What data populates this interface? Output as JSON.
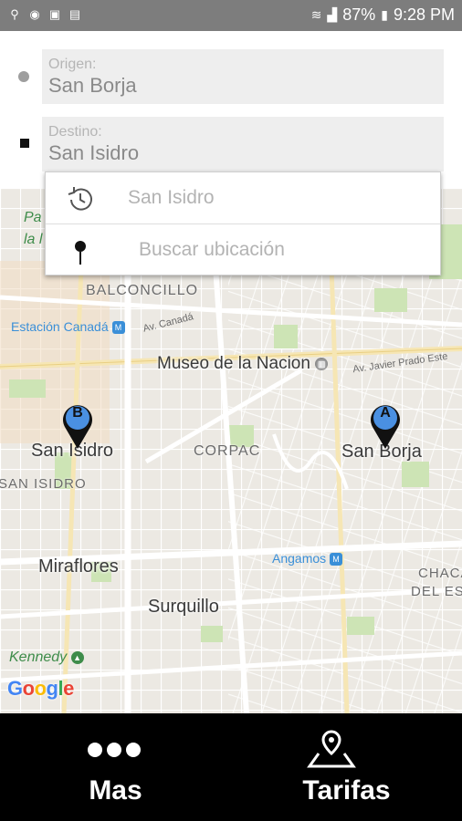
{
  "status_bar": {
    "battery": "87%",
    "time": "9:28 PM",
    "left_icons": [
      "usb-icon",
      "record-icon",
      "office-icon",
      "clipboard-icon"
    ],
    "right_icons": [
      "wifi-icon",
      "signal-icon",
      "battery-icon"
    ]
  },
  "form": {
    "origin_label": "Origen:",
    "origin_value": "San Borja",
    "dest_label": "Destino:",
    "dest_value": "San Isidro"
  },
  "suggestions": [
    {
      "icon": "history-icon",
      "text": "San Isidro"
    },
    {
      "icon": "location-pin-icon",
      "text": "Buscar ubicación"
    }
  ],
  "map": {
    "labels": {
      "balconcillo": "BALCONCILLO",
      "estacion_canada": "Estación Canadá",
      "av_canada": "Av. Canadá",
      "museo": "Museo de la Nacion",
      "javier_prado": "Av. Javier Prado Este",
      "san_isidro": "San Isidro",
      "san_isidro_area": "SAN ISIDRO",
      "corpac": "CORPAC",
      "san_borja": "San Borja",
      "angamos": "Angamos",
      "chaca": "CHACA",
      "del_est": "DEL EST",
      "miraflores": "Miraflores",
      "surquillo": "Surquillo",
      "kennedy": "Kennedy",
      "pa": "Pa",
      "la_l": "la l"
    },
    "markers": [
      {
        "letter": "B",
        "color": "#4a90e2"
      },
      {
        "letter": "A",
        "color": "#4a90e2"
      }
    ],
    "google": [
      "G",
      "o",
      "o",
      "g",
      "l",
      "e"
    ],
    "google_colors": [
      "#4285f4",
      "#ea4335",
      "#fbbc05",
      "#4285f4",
      "#34a853",
      "#ea4335"
    ]
  },
  "bottom_bar": {
    "mas_label": "Mas",
    "tarifas_label": "Tarifas"
  },
  "colors": {
    "map_background": "#ece9e3",
    "park": "#cde4b5",
    "road": "#ffffff",
    "arterial": "#f6e6b4",
    "bottom_bar": "#000000"
  }
}
